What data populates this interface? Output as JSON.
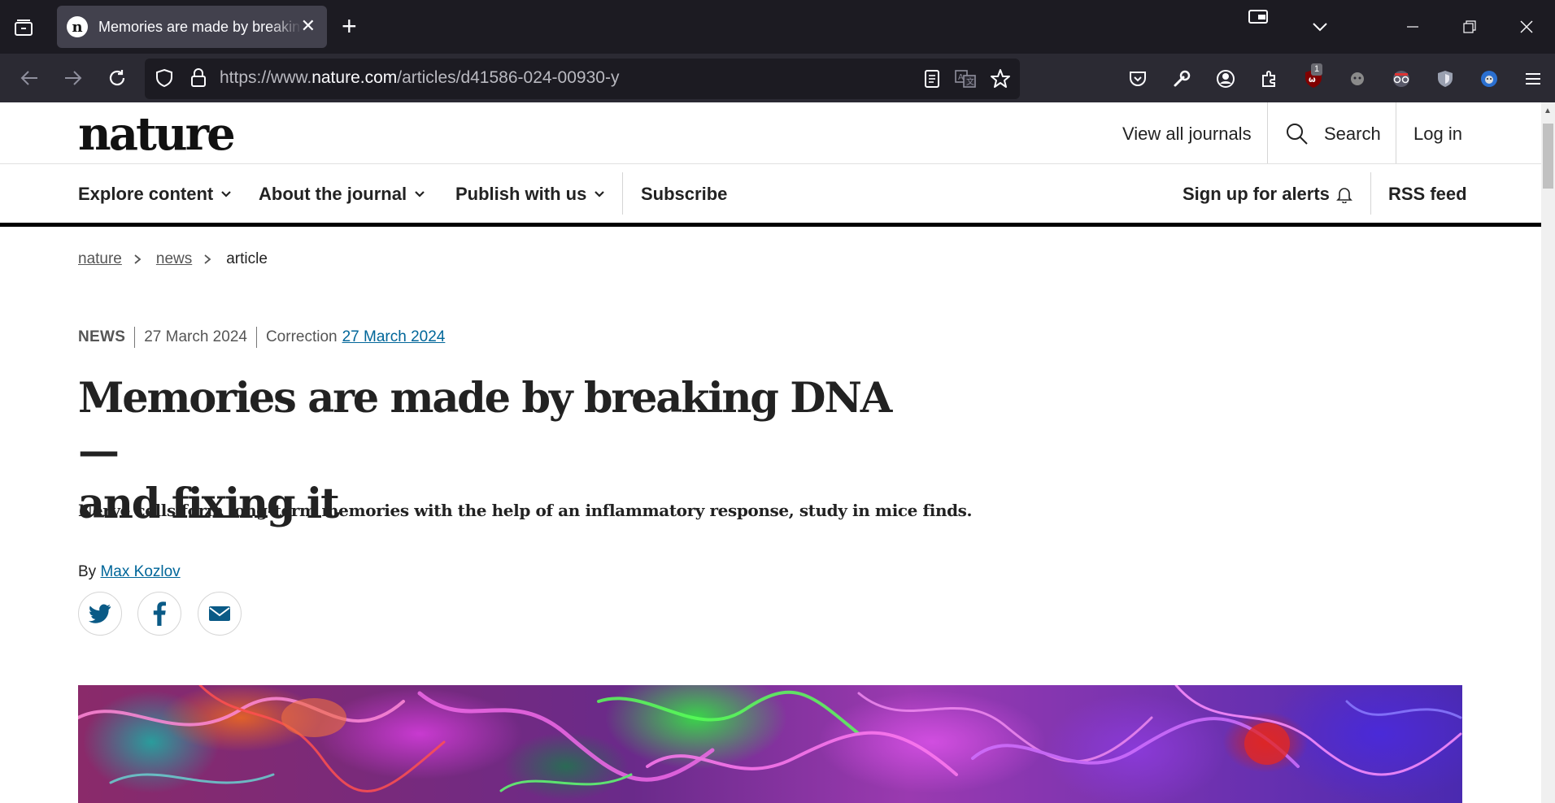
{
  "browser": {
    "tab_title": "Memories are made by breaking DNA — and fixing it",
    "favicon_letter": "n",
    "url_prefix": "https://www.",
    "url_domain": "nature.com",
    "url_path": "/articles/d41586-024-00930-y",
    "extension_badge": "1",
    "icons": [
      "tab-overview-icon",
      "new-tab-icon",
      "window-list-icon",
      "chevron-down-icon",
      "minimize-icon",
      "restore-icon",
      "close-icon",
      "back-icon",
      "forward-icon",
      "reload-icon",
      "shield-icon",
      "lock-icon",
      "reader-view-icon",
      "translate-icon",
      "star-icon",
      "pocket-icon",
      "wrench-icon",
      "account-icon",
      "extensions-icon",
      "ublock-icon",
      "extension-icon",
      "glasses-extension-icon",
      "privacy-badger-icon",
      "tampermonkey-icon",
      "menu-icon"
    ]
  },
  "site": {
    "logo": "nature",
    "view_all_journals": "View all journals",
    "search": "Search",
    "log_in": "Log in",
    "nav": {
      "explore": "Explore content",
      "about": "About the journal",
      "publish": "Publish with us",
      "subscribe": "Subscribe",
      "alerts": "Sign up for alerts",
      "rss": "RSS feed"
    }
  },
  "breadcrumb": [
    "nature",
    "news",
    "article"
  ],
  "article": {
    "type": "NEWS",
    "date": "27 March 2024",
    "correction_label": "Correction",
    "correction_date": "27 March 2024",
    "headline_line1": "Memories are made by breaking DNA —",
    "headline_line2": "and fixing it",
    "standfirst": "Nerve cells form long-term memories with the help of an inflammatory response, study in mice finds.",
    "by_label": "By",
    "author": "Max Kozlov",
    "share": [
      "twitter-icon",
      "facebook-icon",
      "email-icon"
    ]
  },
  "colors": {
    "chrome_dark": "#1c1b22",
    "toolbar": "#2b2a33",
    "link": "#006699",
    "text": "#222222"
  }
}
